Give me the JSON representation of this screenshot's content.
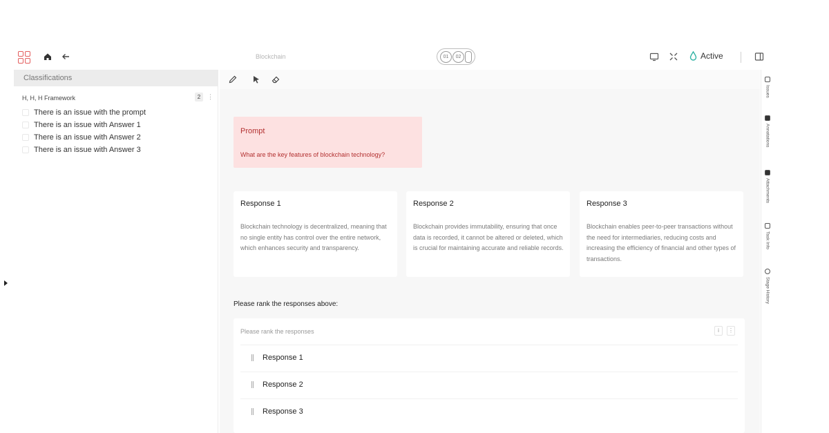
{
  "header": {
    "doc_title": "Blockchain",
    "pager": [
      "01",
      "02"
    ],
    "status": "Active",
    "accent": "#e35d5d",
    "status_color": "#2fb2a3"
  },
  "sidebar": {
    "title": "Classifications",
    "framework": {
      "label": "H, H, H Framework",
      "count": "2",
      "more": "⋮"
    },
    "items": [
      {
        "label": "There is an issue with the prompt"
      },
      {
        "label": "There is an issue with Answer 1"
      },
      {
        "label": "There is an issue with Answer 2"
      },
      {
        "label": "There is an issue with Answer 3"
      }
    ]
  },
  "prompt": {
    "title": "Prompt",
    "text": "What are the key features of blockchain technology?"
  },
  "responses": [
    {
      "title": "Response 1",
      "body": "Blockchain technology is decentralized, meaning that no single entity has control over the entire network, which enhances security and transparency."
    },
    {
      "title": "Response 2",
      "body": "Blockchain provides immutability, ensuring that once data is recorded, it cannot be altered or deleted, which is crucial for maintaining accurate and reliable records."
    },
    {
      "title": "Response 3",
      "body": "Blockchain enables peer-to-peer transactions without the need for intermediaries, reducing costs and increasing the efficiency of financial and other types of transactions."
    }
  ],
  "ranking": {
    "heading": "Please rank the responses above:",
    "hint": "Please rank the responses",
    "items": [
      "Response 1",
      "Response 2",
      "Response 3"
    ]
  },
  "right_rail": [
    "Issues",
    "Annotations",
    "Attachments",
    "Task Info",
    "Stage History"
  ]
}
